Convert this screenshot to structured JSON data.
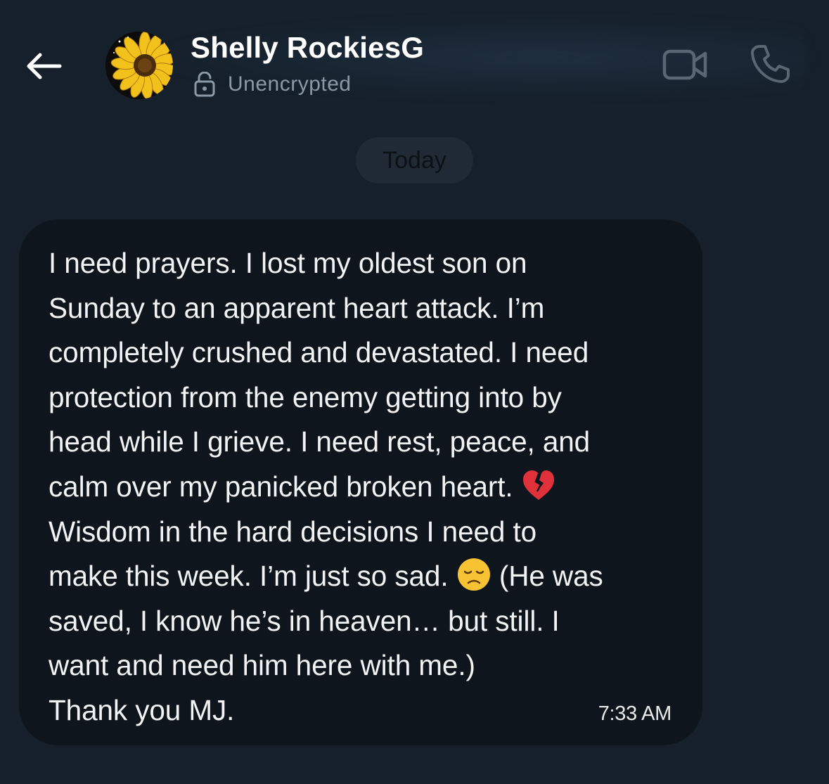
{
  "header": {
    "back_icon": "arrow-left-icon",
    "contact_name": "Shelly RockiesG",
    "encryption_icon": "unlocked-padlock-icon",
    "encryption_status": "Unencrypted",
    "video_call_icon": "video-camera-icon",
    "voice_call_icon": "phone-icon"
  },
  "conversation": {
    "date_separator": "Today",
    "message": {
      "lines_before_heart": "I need prayers. I lost my oldest son on\nSunday to an apparent heart attack. I’m\ncompletely crushed and devastated. I need\nprotection from the enemy getting into by\nhead while I grieve. I need rest, peace, and\ncalm over my panicked broken heart. ",
      "emoji_1": "💔",
      "lines_before_sad": "\nWisdom in the hard decisions I need to\nmake this week. I’m just so sad. ",
      "emoji_2": "😞",
      "lines_after_sad": " (He was\nsaved, I know he’s in heaven… but still. I\nwant and need him here with me.)\nThank you MJ.",
      "timestamp": "7:33 AM"
    }
  },
  "colors": {
    "background": "#15202b",
    "bubble": "#0f151c",
    "secondary_text": "#8b98a5",
    "icon_muted": "#5b6673"
  }
}
